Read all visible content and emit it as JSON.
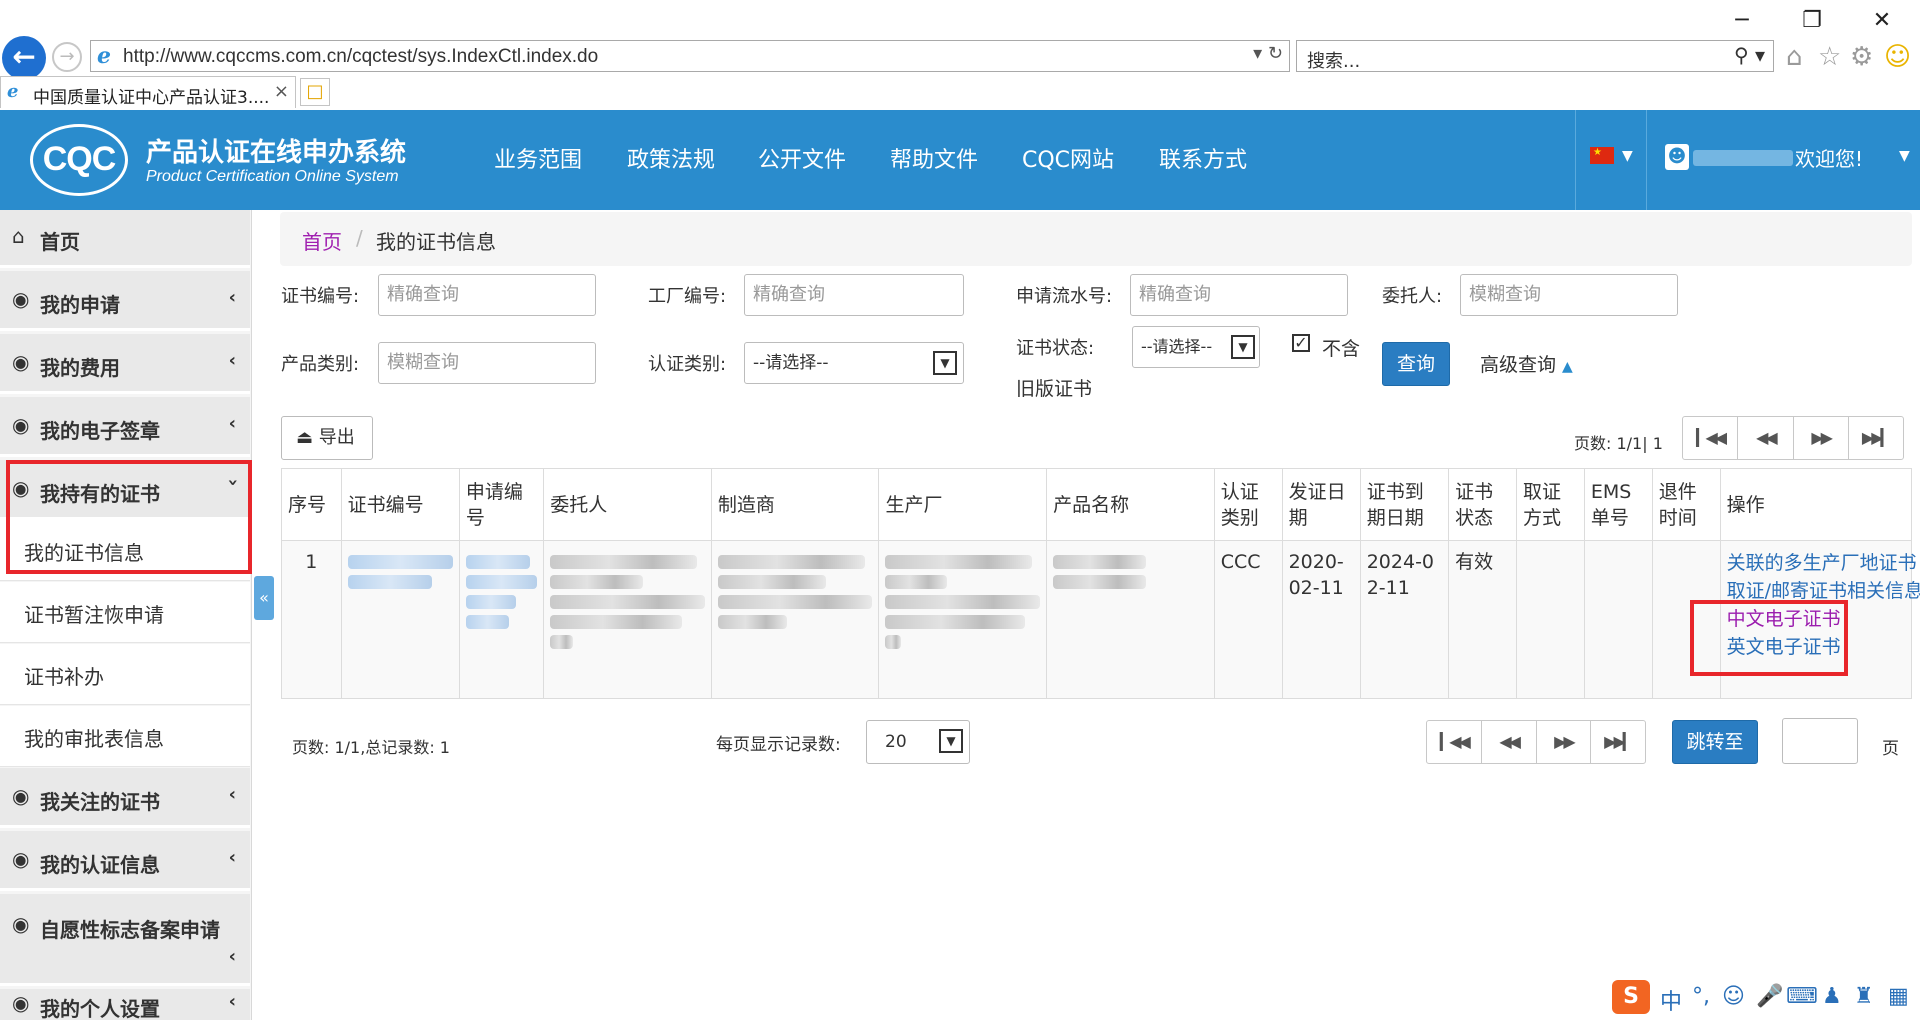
{
  "browser": {
    "url": "http://www.cqccms.com.cn/cqctest/sys.IndexCtl.index.do",
    "search_placeholder": "搜索...",
    "tab_title": "中国质量认证中心产品认证3....",
    "win_min": "─",
    "win_max": "❐",
    "win_close": "✕"
  },
  "header": {
    "logo_text": "CQC",
    "title": "产品认证在线申办系统",
    "subtitle": "Product Certification Online System",
    "nav": [
      "业务范围",
      "政策法规",
      "公开文件",
      "帮助文件",
      "CQC网站",
      "联系方式"
    ],
    "welcome": "欢迎您!"
  },
  "sidebar": {
    "home": "首页",
    "items": [
      {
        "label": "我的申请"
      },
      {
        "label": "我的费用"
      },
      {
        "label": "我的电子签章"
      },
      {
        "label": "我持有的证书"
      }
    ],
    "sub_items": [
      "我的证书信息",
      "证书暂注恢申请",
      "证书补办",
      "我的审批表信息"
    ],
    "items_after": [
      {
        "label": "我关注的证书"
      },
      {
        "label": "我的认证信息"
      },
      {
        "label": "自愿性标志备案申请"
      },
      {
        "label": "我的个人设置"
      }
    ]
  },
  "breadcrumb": {
    "home": "首页",
    "current": "我的证书信息"
  },
  "filters": {
    "cert_no_label": "证书编号:",
    "cert_no_placeholder": "精确查询",
    "factory_no_label": "工厂编号:",
    "factory_no_placeholder": "精确查询",
    "apply_no_label": "申请流水号:",
    "apply_no_placeholder": "精确查询",
    "client_label": "委托人:",
    "client_placeholder": "模糊查询",
    "product_cat_label": "产品类别:",
    "product_cat_placeholder": "模糊查询",
    "cert_type_label": "认证类别:",
    "cert_type_value": "--请选择--",
    "status_label": "证书状态:",
    "status_value": "--请选择--",
    "exclude_label": "不含",
    "old_cert_label": "旧版证书",
    "query_btn": "查询",
    "advanced": "高级查询"
  },
  "toolbar": {
    "export": "导出",
    "page_info": "页数:  1/1| 1"
  },
  "table": {
    "headers": [
      "序号",
      "证书编号",
      "申请编号",
      "委托人",
      "制造商",
      "生产厂",
      "产品名称",
      "认证类别",
      "发证日期",
      "证书到期日期",
      "证书状态",
      "取证方式",
      "EMS单号",
      "退件时间",
      "操作"
    ],
    "rows": [
      {
        "index": "1",
        "cert_type": "CCC",
        "issue_date": "2020-02-11",
        "expire_date": "2024-02-11",
        "status": "有效",
        "ops": [
          "关联的多生产厂地证书",
          "取证/邮寄证书相关信息",
          "中文电子证书",
          "英文电子证书"
        ]
      }
    ]
  },
  "pager": {
    "summary": "页数:  1/1,总记录数:  1",
    "per_page_label": "每页显示记录数:",
    "per_page_value": "20",
    "goto_btn": "跳转至",
    "page_suffix": "页"
  },
  "ime": {
    "mode": "中"
  }
}
